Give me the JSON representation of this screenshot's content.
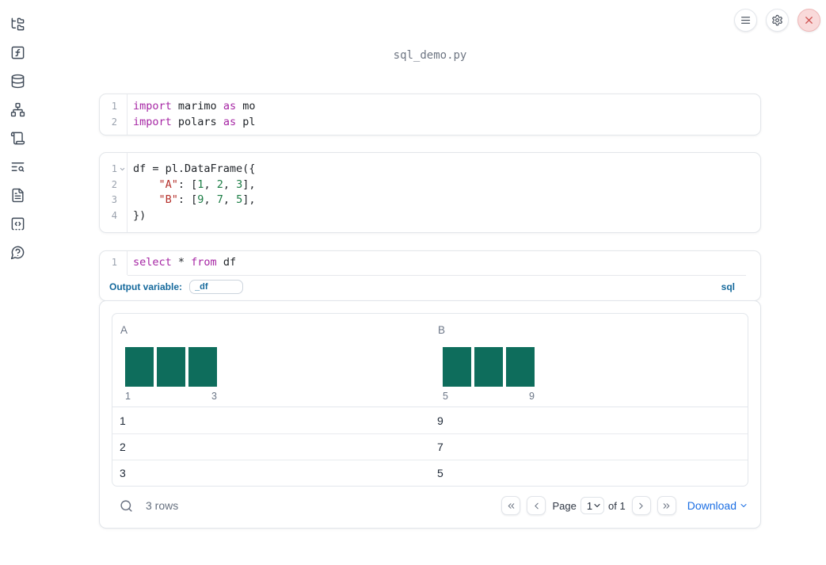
{
  "colors": {
    "keyword": "#a626a4",
    "string": "#b5302b",
    "number": "#1b7d45",
    "accent_blue": "#15699c",
    "link_blue": "#1b6ee3",
    "histogram_bar": "#0e6d5c"
  },
  "notebook": {
    "filename": "sql_demo.py"
  },
  "window": {
    "buttons": [
      {
        "name": "notebook-menu",
        "icon": "menu-icon"
      },
      {
        "name": "settings",
        "icon": "gear-icon"
      },
      {
        "name": "shutdown",
        "icon": "close-icon"
      }
    ]
  },
  "sidebar": {
    "items": [
      {
        "name": "file-explorer",
        "icon": "folder-tree-icon"
      },
      {
        "name": "variables",
        "icon": "function-square-icon"
      },
      {
        "name": "data-sources",
        "icon": "database-icon"
      },
      {
        "name": "dependencies",
        "icon": "network-icon"
      },
      {
        "name": "snippets",
        "icon": "scroll-icon"
      },
      {
        "name": "logs",
        "icon": "text-search-icon"
      },
      {
        "name": "documentation",
        "icon": "file-text-icon"
      },
      {
        "name": "scratchpad",
        "icon": "code-box-icon"
      },
      {
        "name": "help",
        "icon": "help-circle-icon"
      }
    ]
  },
  "cells": [
    {
      "language": "python",
      "lines": [
        {
          "number": "1",
          "tokens": [
            {
              "t": "import",
              "c": "kw"
            },
            {
              "t": " marimo "
            },
            {
              "t": "as",
              "c": "kw"
            },
            {
              "t": " mo"
            }
          ]
        },
        {
          "number": "2",
          "tokens": [
            {
              "t": "import",
              "c": "kw"
            },
            {
              "t": " polars "
            },
            {
              "t": "as",
              "c": "kw"
            },
            {
              "t": " pl"
            }
          ]
        }
      ]
    },
    {
      "language": "python",
      "lines": [
        {
          "number": "1",
          "fold": true,
          "tokens": [
            {
              "t": "df = pl.DataFrame({"
            }
          ]
        },
        {
          "number": "2",
          "tokens": [
            {
              "t": "    "
            },
            {
              "t": "\"A\"",
              "c": "str"
            },
            {
              "t": ": ["
            },
            {
              "t": "1",
              "c": "num"
            },
            {
              "t": ", "
            },
            {
              "t": "2",
              "c": "num"
            },
            {
              "t": ", "
            },
            {
              "t": "3",
              "c": "num"
            },
            {
              "t": "],"
            }
          ]
        },
        {
          "number": "3",
          "tokens": [
            {
              "t": "    "
            },
            {
              "t": "\"B\"",
              "c": "str"
            },
            {
              "t": ": ["
            },
            {
              "t": "9",
              "c": "num"
            },
            {
              "t": ", "
            },
            {
              "t": "7",
              "c": "num"
            },
            {
              "t": ", "
            },
            {
              "t": "5",
              "c": "num"
            },
            {
              "t": "],"
            }
          ]
        },
        {
          "number": "4",
          "tokens": [
            {
              "t": "})"
            }
          ]
        }
      ]
    },
    {
      "language": "sql",
      "lines": [
        {
          "number": "1",
          "tokens": [
            {
              "t": "select",
              "c": "kw"
            },
            {
              "t": " * "
            },
            {
              "t": "from",
              "c": "kw"
            },
            {
              "t": " df"
            }
          ]
        }
      ],
      "footer": {
        "label": "Output variable:",
        "value": "_df",
        "language": "sql"
      }
    }
  ],
  "output_table": {
    "columns": [
      {
        "name": "A",
        "histogram": {
          "type": "bar",
          "counts": [
            1,
            1,
            1
          ],
          "min_label": "1",
          "max_label": "3"
        }
      },
      {
        "name": "B",
        "histogram": {
          "type": "bar",
          "counts": [
            1,
            1,
            1
          ],
          "min_label": "5",
          "max_label": "9"
        }
      }
    ],
    "rows": [
      [
        "1",
        "9"
      ],
      [
        "2",
        "7"
      ],
      [
        "3",
        "5"
      ]
    ],
    "footer": {
      "row_count": "3 rows",
      "page_label": "Page",
      "page_value": "1",
      "of_label": "of 1",
      "download_label": "Download"
    }
  }
}
